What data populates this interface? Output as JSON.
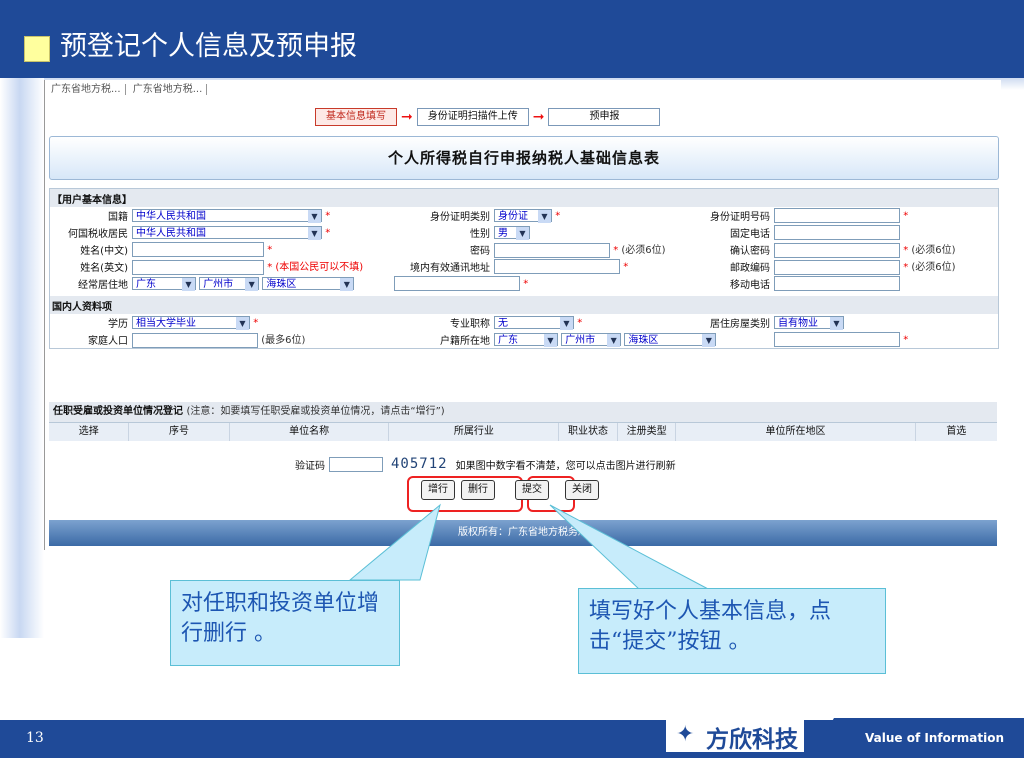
{
  "slide": {
    "title": "预登记个人信息及预申报",
    "page_number": "13"
  },
  "breadcrumb": [
    "广东省地方税...",
    "广东省地方税..."
  ],
  "steps": [
    {
      "label": "基本信息填写",
      "active": true
    },
    {
      "label": "身份证明扫描件上传",
      "active": false
    },
    {
      "label": "预申报",
      "active": false
    }
  ],
  "form": {
    "title": "个人所得税自行申报纳税人基础信息表",
    "section_basic": "【用户基本信息】",
    "section_domestic": "国内人资料项",
    "section_invest": "任职受雇或投资单位情况登记",
    "invest_note": "(注意：如要填写任职受雇或投资单位情况，请点击“增行”)",
    "labels": {
      "nationality": "国籍",
      "id_type": "身份证明类别",
      "id_no": "身份证明号码",
      "tax_resident": "何国税收居民",
      "gender": "性别",
      "fixed_phone": "固定电话",
      "name_cn": "姓名(中文)",
      "password": "密码",
      "confirm_password": "确认密码",
      "name_en": "姓名(英文)",
      "address": "境内有效通讯地址",
      "postcode": "邮政编码",
      "residence": "经常居住地",
      "mobile": "移动电话",
      "education": "学历",
      "title_pro": "专业职称",
      "housing": "居住房屋类别",
      "family": "家庭人口",
      "hukou": "户籍所在地"
    },
    "values": {
      "nationality": "中华人民共和国",
      "id_type": "身份证",
      "tax_resident": "中华人民共和国",
      "gender": "男",
      "province": "广东",
      "city": "广州市",
      "district": "海珠区",
      "education": "相当大学毕业",
      "title_pro": "无",
      "housing": "自有物业",
      "hukou_province": "广东",
      "hukou_city": "广州市",
      "hukou_district": "海珠区"
    },
    "hints": {
      "six_digits": "(必须6位)",
      "english_name": "(本国公民可以不填)",
      "family_max": "(最多6位)"
    },
    "invest_columns": [
      "选择",
      "序号",
      "单位名称",
      "所属行业",
      "职业状态",
      "注册类型",
      "单位所在地区",
      "首选"
    ],
    "captcha_label": "验证码",
    "captcha_code": "405712",
    "captcha_hint": "如果图中数字看不清楚，您可以点击图片进行刷新",
    "buttons": {
      "add": "增行",
      "delete": "删行",
      "submit": "提交",
      "close": "关闭"
    },
    "footer": "版权所有：广东省地方税务局"
  },
  "callouts": {
    "left": "对任职和投资单位增行删行 。",
    "right": "填写好个人基本信息，点击“提交”按钮 。"
  },
  "brand": {
    "logo_text": "方欣科技",
    "tagline": "Value of Information"
  },
  "colors": {
    "primary": "#1f4a98",
    "callout_bg": "#c7ecfb",
    "highlight": "#e22222"
  }
}
